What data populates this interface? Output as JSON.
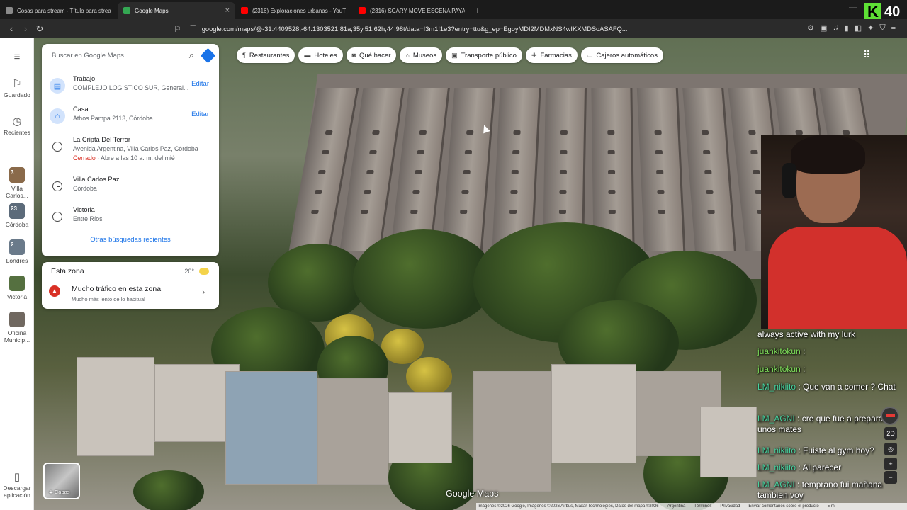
{
  "browser": {
    "tabs": [
      {
        "title": "Cosas para stream - Título para strea",
        "fav_color": "#8a8a8a",
        "active": false
      },
      {
        "title": "Google Maps",
        "fav_color": "#34a853",
        "active": true
      },
      {
        "title": "(2316) Exploraciones urbanas - YouT",
        "fav_color": "#ff0000",
        "active": false
      },
      {
        "title": "(2316) SCARY MOVE ESCENA PAYASO",
        "fav_color": "#ff0000",
        "active": false
      }
    ],
    "url": "google.com/maps/@-31.4409528,-64.1303521,81a,35y,51.62h,44.98t/data=!3m1!1e3?entry=ttu&g_ep=EgoyMDI2MDMxNS4wIKXMDSoASAFQ..."
  },
  "overlay": {
    "k_count": "40"
  },
  "rail": {
    "saved": "Guardado",
    "recent": "Recientes",
    "places": [
      {
        "label": "Villa Carlos...",
        "badge": "3",
        "color": "#8a6a4a"
      },
      {
        "label": "Córdoba",
        "badge": "23",
        "color": "#5c6b7a"
      },
      {
        "label": "Londres",
        "badge": "2",
        "color": "#6a7a8a"
      },
      {
        "label": "Victoria",
        "badge": "",
        "color": "#557040"
      },
      {
        "label": "Oficina Municip...",
        "badge": "",
        "color": "#706860"
      }
    ],
    "download": "Descargar aplicación"
  },
  "search": {
    "placeholder": "Buscar en Google Maps"
  },
  "recents": [
    {
      "title": "Trabajo",
      "sub": "COMPLEJO LOGISTICO SUR, General...",
      "edit": "Editar",
      "icon": "briefcase-icon"
    },
    {
      "title": "Casa",
      "sub": "Athos Pampa 2113, Córdoba",
      "edit": "Editar",
      "icon": "home-icon"
    },
    {
      "title": "La Cripta Del Terror",
      "sub": "Avenida Argentina, Villa Carlos Paz, Córdoba",
      "status": "Cerrado",
      "hours": " · Abre a las 10 a. m. del mié",
      "icon": "clock-icon"
    },
    {
      "title": "Villa Carlos Paz",
      "sub": "Córdoba",
      "icon": "clock-icon"
    },
    {
      "title": "Victoria",
      "sub": "Entre Ríos",
      "icon": "clock-icon"
    }
  ],
  "more_searches": "Otras búsquedas recientes",
  "zone": {
    "title": "Esta zona",
    "temp": "20°",
    "alert_title": "Mucho tráfico en esta zona",
    "alert_sub": "Mucho más lento de lo habitual"
  },
  "chips": [
    {
      "label": "Restaurantes",
      "icon": "fork-icon"
    },
    {
      "label": "Hoteles",
      "icon": "bed-icon"
    },
    {
      "label": "Qué hacer",
      "icon": "camera-icon"
    },
    {
      "label": "Museos",
      "icon": "museum-icon"
    },
    {
      "label": "Transporte público",
      "icon": "train-icon"
    },
    {
      "label": "Farmacias",
      "icon": "pharmacy-icon"
    },
    {
      "label": "Cajeros automáticos",
      "icon": "atm-icon"
    }
  ],
  "chat": [
    {
      "user": "",
      "text": "always active with my lurk"
    },
    {
      "user": "juankitokun",
      "text": " :"
    },
    {
      "user": "juankitokun",
      "text": " :"
    },
    {
      "user": "LM_nikiito",
      "text": " : Que van a comer ? Chat"
    },
    {
      "user": "LM_AGNI",
      "text": " : cre que fue a preparase unos mates"
    },
    {
      "user": "LM_nikiito",
      "text": " : Fuiste al gym hoy?"
    },
    {
      "user": "LM_nikiito",
      "text": " : Al parecer"
    },
    {
      "user": "LM_AGNI",
      "text": " : temprano fui mañana tambien voy"
    }
  ],
  "map": {
    "layers_label": "Capas",
    "logo": "Google Maps",
    "credits": [
      "Imágenes ©2026 Google, Imágenes ©2026 Airbus, Maxar Technologies, Datos del mapa ©2026",
      "Argentina",
      "Términos",
      "Privacidad",
      "Enviar comentarios sobre el producto",
      "5 m"
    ],
    "ctrl_2d": "2D"
  }
}
